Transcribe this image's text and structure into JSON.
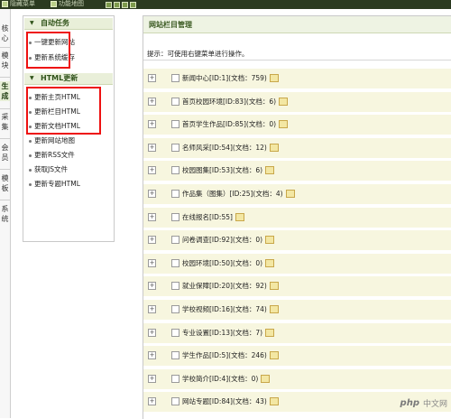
{
  "topbar": {
    "hide_menu": "隐藏菜单",
    "feature_map": "功能地图"
  },
  "tabs": [
    "核心",
    "模块",
    "生成",
    "采集",
    "会员",
    "模板",
    "系统"
  ],
  "menu": {
    "section1": {
      "title": "自动任务",
      "items": [
        "一键更新网站",
        "更新系统缓存"
      ]
    },
    "section2": {
      "title": "HTML更新",
      "items": [
        "更新主页HTML",
        "更新栏目HTML",
        "更新文档HTML",
        "更新网站地图",
        "更新RSS文件",
        "获取JS文件",
        "更新专题HTML"
      ]
    }
  },
  "main": {
    "title": "网站栏目管理",
    "hint": "提示：可使用右键菜单进行操作。",
    "rows": [
      "新闻中心[ID:1](文档：759)",
      "首页校园环境[ID:83](文档：6)",
      "首页学生作品[ID:85](文档：0)",
      "名师风采[ID:54](文档：12)",
      "校园图集[ID:53](文档：6)",
      "作品集（图集）[ID:25](文档：4)",
      "在线报名[ID:55]",
      "问卷调查[ID:92](文档：0)",
      "校园环境[ID:50](文档：0)",
      "就业保障[ID:20](文档：92)",
      "学校视频[ID:16](文档：74)",
      "专业设置[ID:13](文档：7)",
      "学生作品[ID:5](文档：246)",
      "学校简介[ID:4](文档：0)",
      "网站专题[ID:84](文档：43)"
    ]
  },
  "watermark": {
    "logo": "php",
    "text": "中文网"
  },
  "colors": {
    "accent": "#3b5a22",
    "row_bg": "#f7f6df",
    "highlight": "#ee1111"
  }
}
